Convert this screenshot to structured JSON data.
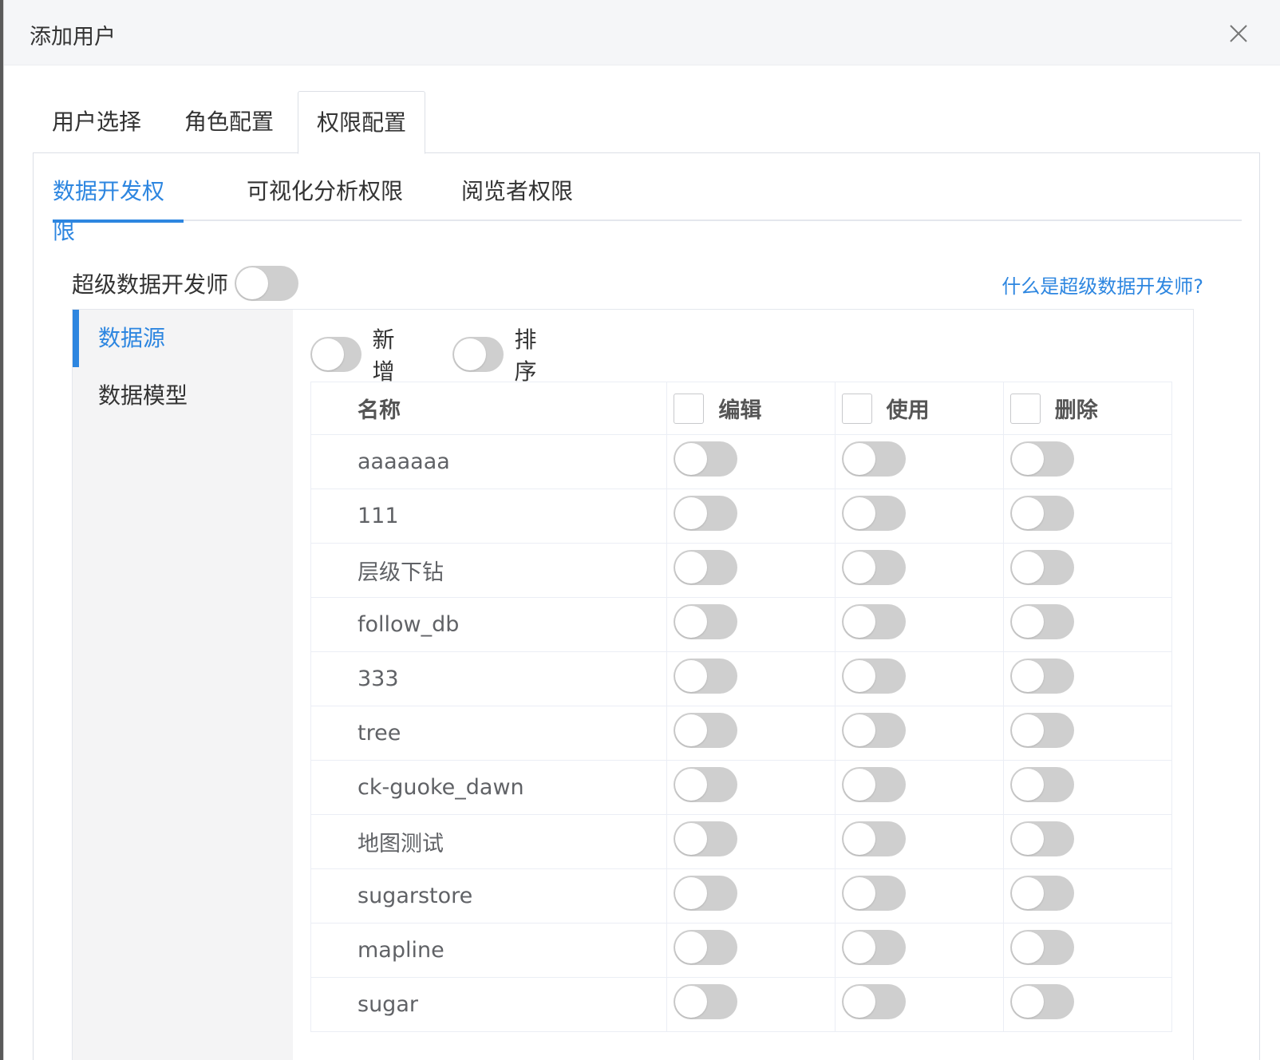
{
  "dialog": {
    "title": "添加用户"
  },
  "tabs_primary": [
    {
      "label": "用户选择"
    },
    {
      "label": "角色配置"
    },
    {
      "label": "权限配置"
    }
  ],
  "tabs_secondary": [
    {
      "label": "数据开发权限"
    },
    {
      "label": "可视化分析权限"
    },
    {
      "label": "阅览者权限"
    }
  ],
  "super": {
    "label": "超级数据开发师",
    "enabled": false,
    "help_link": "什么是超级数据开发师?"
  },
  "side_nav": [
    {
      "label": "数据源"
    },
    {
      "label": "数据模型"
    }
  ],
  "toggles": [
    {
      "label": "新增",
      "enabled": false
    },
    {
      "label": "排序",
      "enabled": false
    }
  ],
  "table": {
    "headers": [
      "名称",
      "编辑",
      "使用",
      "删除"
    ],
    "rows": [
      {
        "name": "aaaaaaa"
      },
      {
        "name": "111"
      },
      {
        "name": "层级下钻"
      },
      {
        "name": "follow_db"
      },
      {
        "name": "333"
      },
      {
        "name": "tree"
      },
      {
        "name": "ck-guoke_dawn"
      },
      {
        "name": "地图测试"
      },
      {
        "name": "sugarstore"
      },
      {
        "name": "mapline"
      },
      {
        "name": "sugar"
      }
    ]
  },
  "colors": {
    "accent": "#2d86e0",
    "switch_off": "#cfcfcf"
  }
}
